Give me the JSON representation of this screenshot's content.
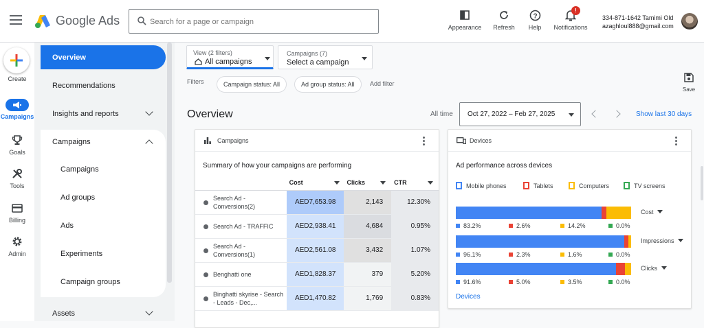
{
  "header": {
    "brand": "Google Ads",
    "search_placeholder": "Search for a page or campaign",
    "buttons": [
      {
        "label": "Appearance",
        "icon": "appearance-icon"
      },
      {
        "label": "Refresh",
        "icon": "refresh-icon"
      },
      {
        "label": "Help",
        "icon": "help-icon"
      },
      {
        "label": "Notifications",
        "icon": "bell-icon",
        "badge": "!"
      }
    ],
    "account_line1": "334-871-1642 Tamimi Old",
    "account_line2": "azaghloul888@gmail.com"
  },
  "rail": {
    "create": "Create",
    "items": [
      "Campaigns",
      "Goals",
      "Tools",
      "Billing",
      "Admin"
    ]
  },
  "nav": {
    "overview": "Overview",
    "recommendations": "Recommendations",
    "insights": "Insights and reports",
    "campaigns_group": "Campaigns",
    "sub_items": [
      "Campaigns",
      "Ad groups",
      "Ads",
      "Experiments",
      "Campaign groups"
    ],
    "assets": "Assets"
  },
  "filters": {
    "view_label": "View (2 filters)",
    "view_value": "All campaigns",
    "campaigns_label": "Campaigns (7)",
    "campaigns_value": "Select a campaign",
    "filters_label": "Filters",
    "pill_status": "Campaign status: All",
    "pill_adgroup": "Ad group status: All",
    "add_filter": "Add filter",
    "save": "Save"
  },
  "overview": {
    "title": "Overview",
    "range_label": "All time",
    "date_range": "Oct 27, 2022 – Feb 27, 2025",
    "show_last": "Show last 30 days"
  },
  "campaigns_card": {
    "title": "Campaigns",
    "subtitle": "Summary of how your campaigns are performing",
    "columns": [
      "Cost",
      "Clicks",
      "CTR"
    ],
    "rows": [
      {
        "name": "Search Ad - Conversions(2)",
        "cost": "AED7,653.98",
        "clicks": "2,143",
        "ctr": "12.30%"
      },
      {
        "name": "Search Ad - TRAFFIC",
        "cost": "AED2,938.41",
        "clicks": "4,684",
        "ctr": "0.95%"
      },
      {
        "name": "Search Ad - Conversions(1)",
        "cost": "AED2,561.08",
        "clicks": "3,432",
        "ctr": "1.07%"
      },
      {
        "name": "Benghatti one",
        "cost": "AED1,828.37",
        "clicks": "379",
        "ctr": "5.20%"
      },
      {
        "name": "Binghatti skyrise - Search - Leads - Dec,...",
        "cost": "AED1,470.82",
        "clicks": "1,769",
        "ctr": "0.83%"
      }
    ],
    "colors": {
      "cost_strong": "#aecbfa",
      "cost_light": "#d2e3fc",
      "clicks_strong": "#e0e0e0",
      "clicks_light": "#f1f3f4"
    },
    "cost_weights": [
      1,
      0.38,
      0.33,
      0.24,
      0.19
    ],
    "clicks_weights": [
      0.46,
      1,
      0.73,
      0.08,
      0.38
    ]
  },
  "devices_card": {
    "title": "Devices",
    "subtitle": "Ad performance across devices",
    "legend": [
      "Mobile phones",
      "Tablets",
      "Computers",
      "TV screens"
    ],
    "colors": [
      "#4285f4",
      "#ea4335",
      "#fbbc04",
      "#34a853"
    ],
    "metrics": [
      {
        "label": "Cost",
        "values": [
          "83.2%",
          "2.6%",
          "14.2%",
          "0.0%"
        ],
        "shares": [
          83.2,
          2.6,
          14.2,
          0.0
        ]
      },
      {
        "label": "Impressions",
        "values": [
          "96.1%",
          "2.3%",
          "1.6%",
          "0.0%"
        ],
        "shares": [
          96.1,
          2.3,
          1.6,
          0.0
        ]
      },
      {
        "label": "Clicks",
        "values": [
          "91.6%",
          "5.0%",
          "3.5%",
          "0.0%"
        ],
        "shares": [
          91.6,
          5.0,
          3.5,
          0.0
        ]
      }
    ],
    "link": "Devices"
  }
}
